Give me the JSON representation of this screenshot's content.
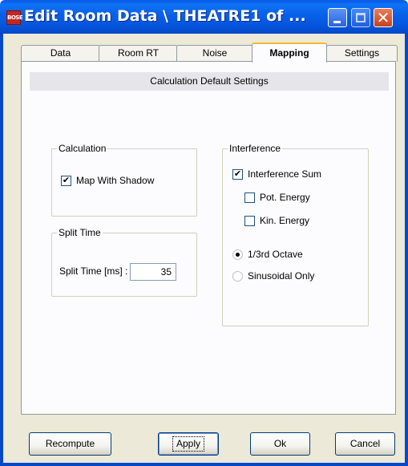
{
  "window": {
    "title": "Edit Room Data \\ THEATRE1 of ...",
    "app_icon_text": "BOSE",
    "controls": {
      "minimize_icon": "minimize-icon",
      "maximize_icon": "maximize-icon",
      "close_icon": "close-icon",
      "close_glyph": "✕"
    },
    "colors": {
      "titlebar": "#0a5ee8",
      "close_button": "#c8411a",
      "panel_bg": "#ece9d8",
      "active_tab_accent": "#f5b831"
    }
  },
  "tabs": [
    {
      "label": "Data",
      "active": false
    },
    {
      "label": "Room RT",
      "active": false
    },
    {
      "label": "Noise",
      "active": false
    },
    {
      "label": "Mapping",
      "active": true
    },
    {
      "label": "Settings",
      "active": false
    }
  ],
  "mapping": {
    "section_title": "Calculation Default Settings",
    "calculation": {
      "legend": "Calculation",
      "map_with_shadow": {
        "label": "Map With Shadow",
        "checked": true,
        "mark": "✔"
      }
    },
    "split_time": {
      "legend": "Split Time",
      "label": "Split Time [ms] :",
      "value": "35"
    },
    "interference": {
      "legend": "Interference",
      "interference_sum": {
        "label": "Interference Sum",
        "checked": true,
        "mark": "✔"
      },
      "pot_energy": {
        "label": "Pot. Energy",
        "checked": false
      },
      "kin_energy": {
        "label": "Kin. Energy",
        "checked": false
      },
      "third_octave": {
        "label": "1/3rd Octave",
        "selected": true
      },
      "sinusoidal_only": {
        "label": "Sinusoidal Only",
        "selected": false
      }
    }
  },
  "buttons": {
    "recompute": "Recompute",
    "apply": "Apply",
    "ok": "Ok",
    "cancel": "Cancel"
  }
}
